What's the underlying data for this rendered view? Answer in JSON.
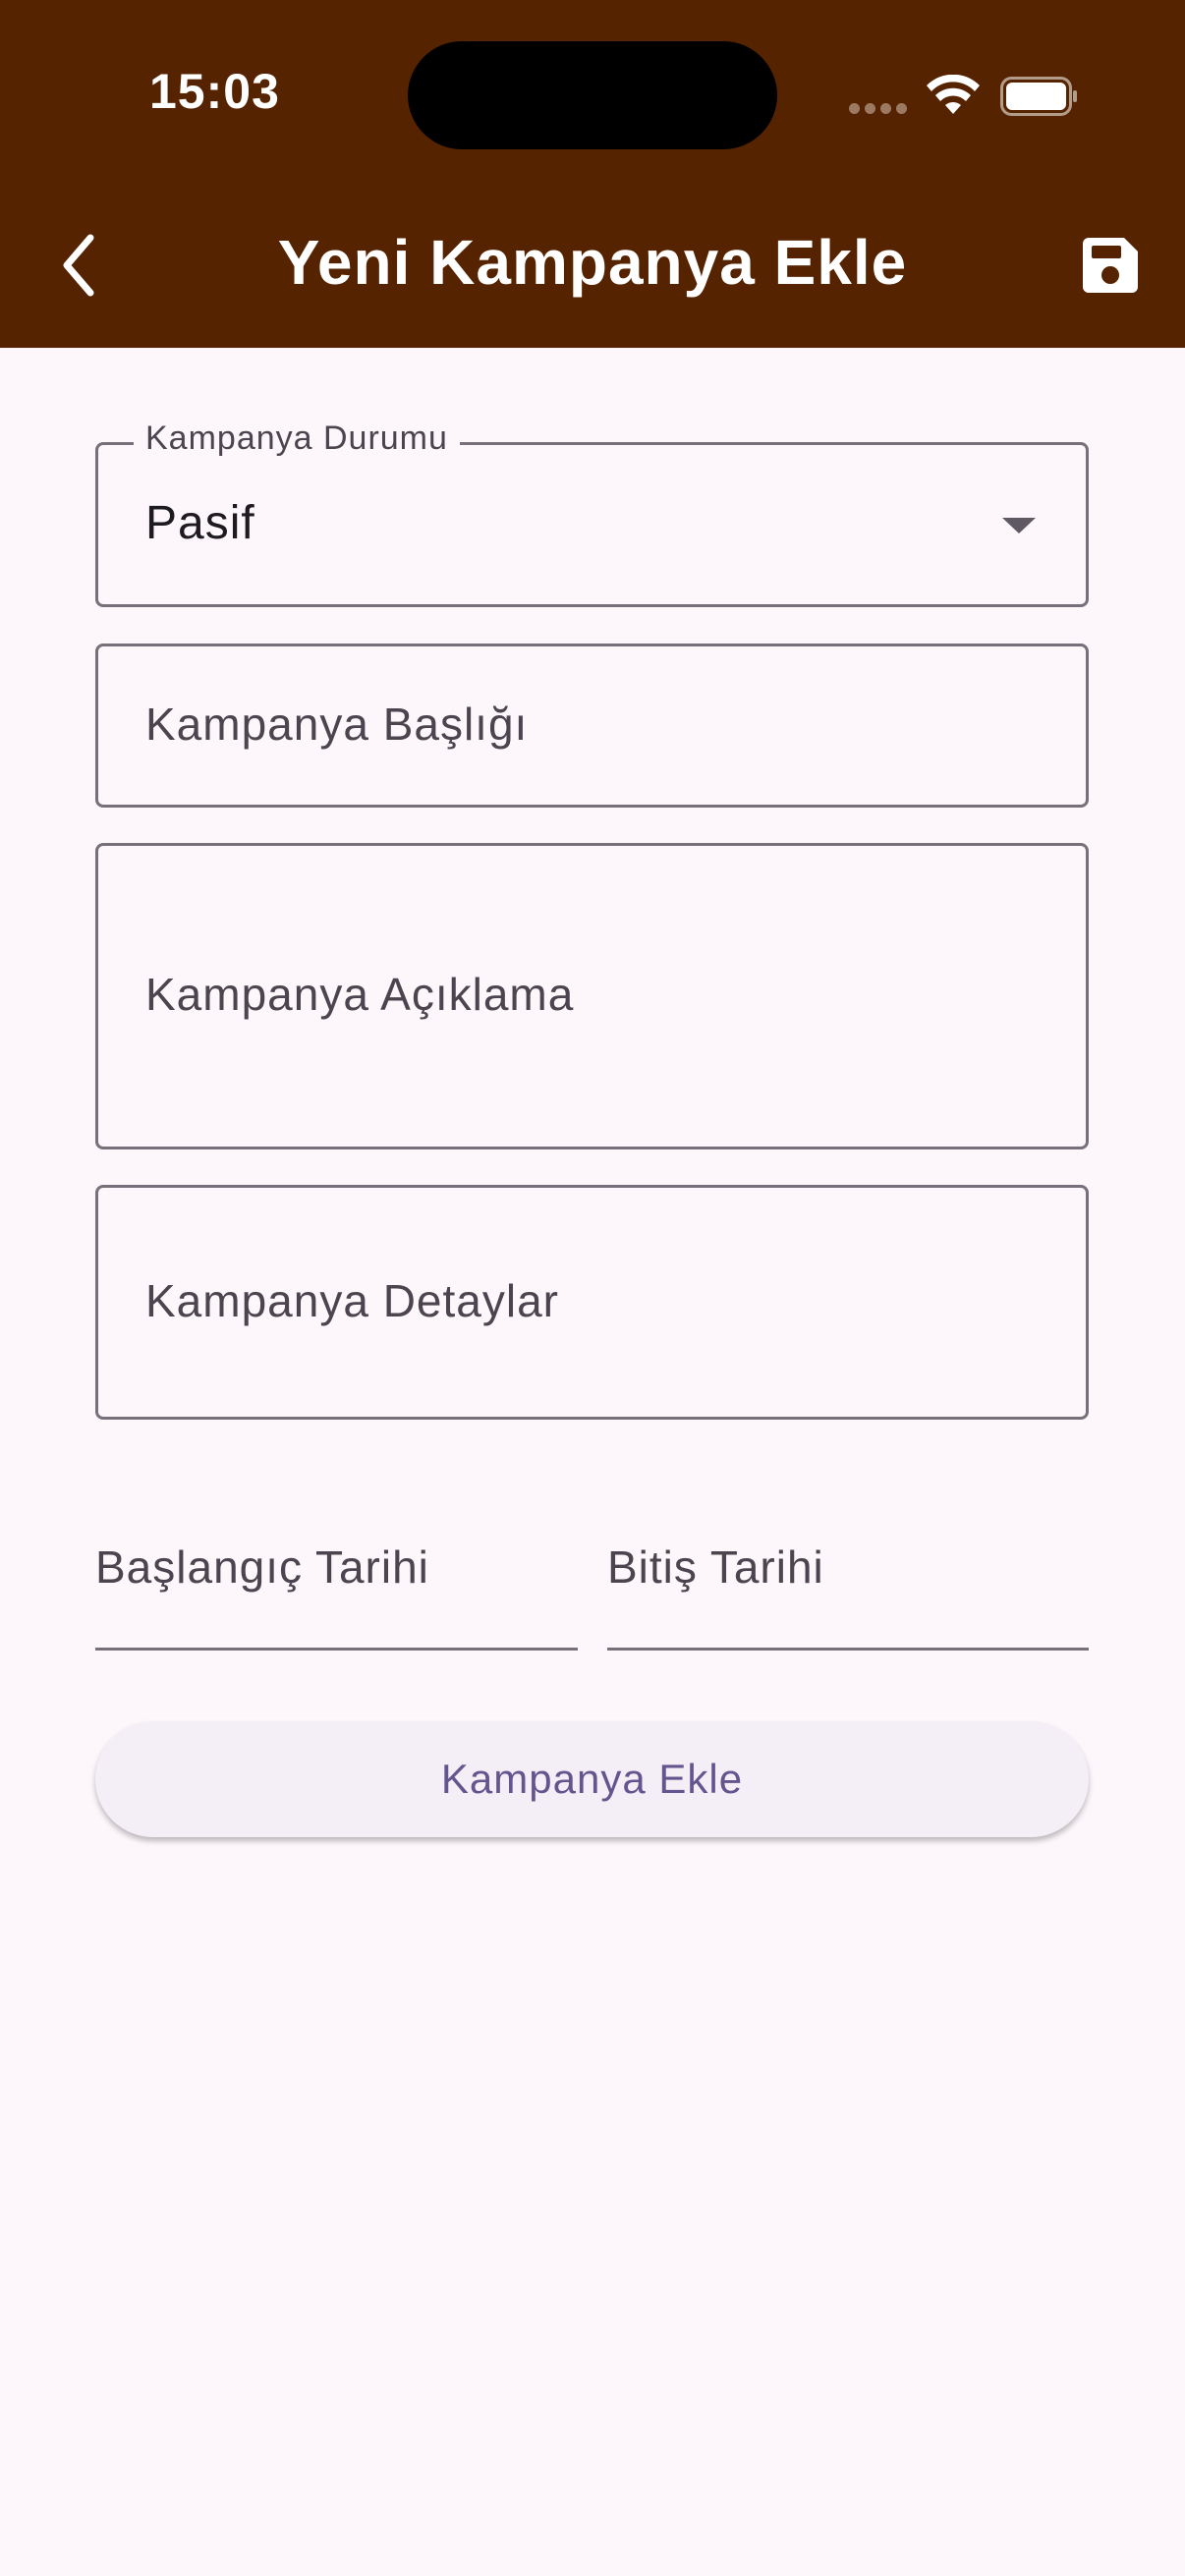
{
  "status_bar": {
    "time": "15:03"
  },
  "header": {
    "title": "Yeni Kampanya Ekle",
    "background_color": "#562300",
    "back_icon": "chevron-left-icon",
    "save_icon": "save-icon"
  },
  "form": {
    "status_select": {
      "label": "Kampanya Durumu",
      "value": "Pasif"
    },
    "title_field": {
      "label": "Kampanya Başlığı"
    },
    "description_field": {
      "label": "Kampanya Açıklama"
    },
    "details_field": {
      "label": "Kampanya Detaylar"
    },
    "start_date_field": {
      "label": "Başlangıç Tarihi"
    },
    "end_date_field": {
      "label": "Bitiş Tarihi"
    },
    "submit_button": {
      "label": "Kampanya Ekle",
      "text_color": "#65558F"
    }
  }
}
